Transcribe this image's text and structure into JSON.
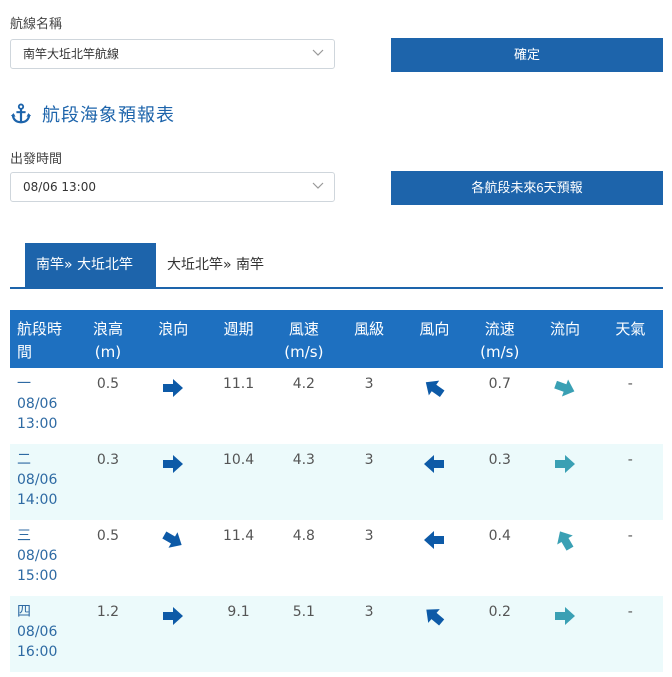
{
  "route": {
    "label": "航線名稱",
    "selected": "南竿大坵北竿航線",
    "confirm_label": "確定"
  },
  "section": {
    "title": "航段海象預報表",
    "icon": "anchor-icon"
  },
  "departure": {
    "label": "出發時間",
    "selected": "08/06 13:00",
    "forecast_label": "各航段未來6天預報"
  },
  "tabs": [
    {
      "label": "南竿» 大坵北竿"
    },
    {
      "label": "大坵北竿» 南竿"
    }
  ],
  "table": {
    "headers": [
      [
        "航段時",
        "間"
      ],
      [
        "浪高",
        "(m)"
      ],
      [
        "浪向",
        ""
      ],
      [
        "週期",
        ""
      ],
      [
        "風速",
        "(m/s)"
      ],
      [
        "風級",
        ""
      ],
      [
        "風向",
        ""
      ],
      [
        "流速",
        "(m/s)"
      ],
      [
        "流向",
        ""
      ],
      [
        "天氣",
        ""
      ]
    ],
    "rows": [
      {
        "seg": "一",
        "date": "08/06",
        "time": "13:00",
        "wave_height": "0.5",
        "wave_dir_deg": 0,
        "period": "11.1",
        "wind_speed": "4.2",
        "wind_level": "3",
        "wind_dir_deg": 215,
        "current_speed": "0.7",
        "current_dir_deg": 20,
        "weather": "-"
      },
      {
        "seg": "二",
        "date": "08/06",
        "time": "14:00",
        "wave_height": "0.3",
        "wave_dir_deg": 0,
        "period": "10.4",
        "wind_speed": "4.3",
        "wind_level": "3",
        "wind_dir_deg": 180,
        "current_speed": "0.3",
        "current_dir_deg": 0,
        "weather": "-"
      },
      {
        "seg": "三",
        "date": "08/06",
        "time": "15:00",
        "wave_height": "0.5",
        "wave_dir_deg": 30,
        "period": "11.4",
        "wind_speed": "4.8",
        "wind_level": "3",
        "wind_dir_deg": 180,
        "current_speed": "0.4",
        "current_dir_deg": 240,
        "weather": "-"
      },
      {
        "seg": "四",
        "date": "08/06",
        "time": "16:00",
        "wave_height": "1.2",
        "wave_dir_deg": 0,
        "period": "9.1",
        "wind_speed": "5.1",
        "wind_level": "3",
        "wind_dir_deg": 220,
        "current_speed": "0.2",
        "current_dir_deg": 0,
        "weather": "-"
      }
    ]
  },
  "colors": {
    "primary": "#1d64ab",
    "header_bg": "#1e70c0",
    "wave_arrow": "#0d5aa7",
    "current_arrow": "#3aa0b4",
    "alt_row": "#ecfafb"
  }
}
